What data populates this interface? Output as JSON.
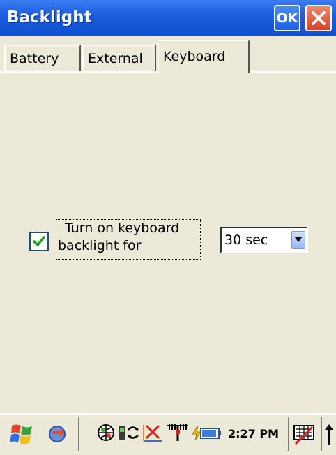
{
  "window": {
    "title": "Backlight",
    "ok_label": "OK"
  },
  "tabs": [
    {
      "label": "Battery"
    },
    {
      "label": "External"
    },
    {
      "label": "Keyboard"
    }
  ],
  "keyboard_tab": {
    "checkbox_checked": true,
    "checkbox_label_line1": "Turn on keyboard",
    "checkbox_label_line2": "backlight  for",
    "timeout_value": "30 sec"
  },
  "taskbar": {
    "clock": "2:27 PM",
    "icons": [
      "windows-start-icon",
      "connectivity-icon",
      "network-globe-icon",
      "sync-icon",
      "disconnected-icon",
      "signal-antenna-icon",
      "battery-icon",
      "keyboard-input-icon",
      "up-arrow-icon"
    ]
  },
  "colors": {
    "titlebar": "#1d5fe0",
    "background": "#ece9d8",
    "close": "#d4432a"
  }
}
